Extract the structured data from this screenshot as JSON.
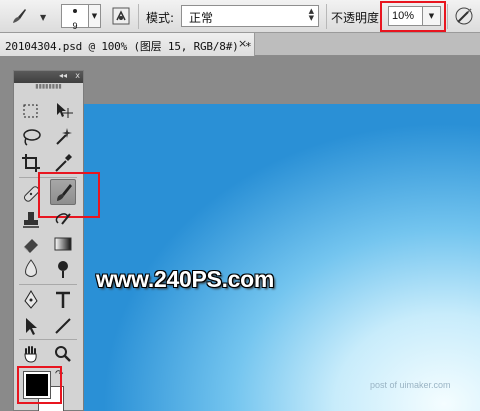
{
  "options_bar": {
    "brush_size": "9",
    "mode_label": "模式:",
    "mode_value": "正常",
    "opacity_label": "不透明度:",
    "opacity_value": "10%"
  },
  "document": {
    "tab_title": "20104304.psd @ 100% (图层 15, RGB/8#) *",
    "close_glyph": "×"
  },
  "toolbox": {
    "collapse_glyph": "◂◂",
    "close_glyph": "x",
    "active_tool": "brush-tool",
    "foreground_color": "#000000",
    "background_color": "#ffffff"
  },
  "canvas": {
    "watermark": "www.240PS.com",
    "credit": "post of uimaker.com"
  },
  "highlight_color": "#e8151f"
}
